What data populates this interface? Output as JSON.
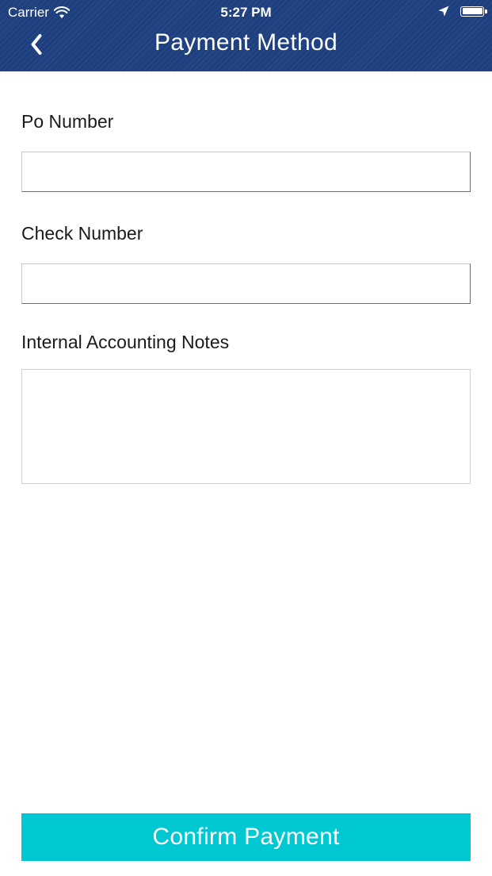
{
  "status_bar": {
    "carrier": "Carrier",
    "time": "5:27 PM",
    "icons": [
      "wifi-icon",
      "location-arrow-icon",
      "battery-icon"
    ]
  },
  "nav": {
    "title": "Payment Method",
    "back_icon": "chevron-left-icon"
  },
  "form": {
    "po_number": {
      "label": "Po Number",
      "value": "",
      "placeholder": ""
    },
    "check_number": {
      "label": "Check Number",
      "value": "",
      "placeholder": ""
    },
    "internal_notes": {
      "label": "Internal Accounting Notes",
      "value": "",
      "placeholder": ""
    }
  },
  "actions": {
    "confirm_label": "Confirm Payment"
  },
  "colors": {
    "nav_background": "#1d3f7e",
    "button_background": "#00c8d2",
    "button_text": "#ffffff",
    "label_text": "#1a1a1a"
  }
}
